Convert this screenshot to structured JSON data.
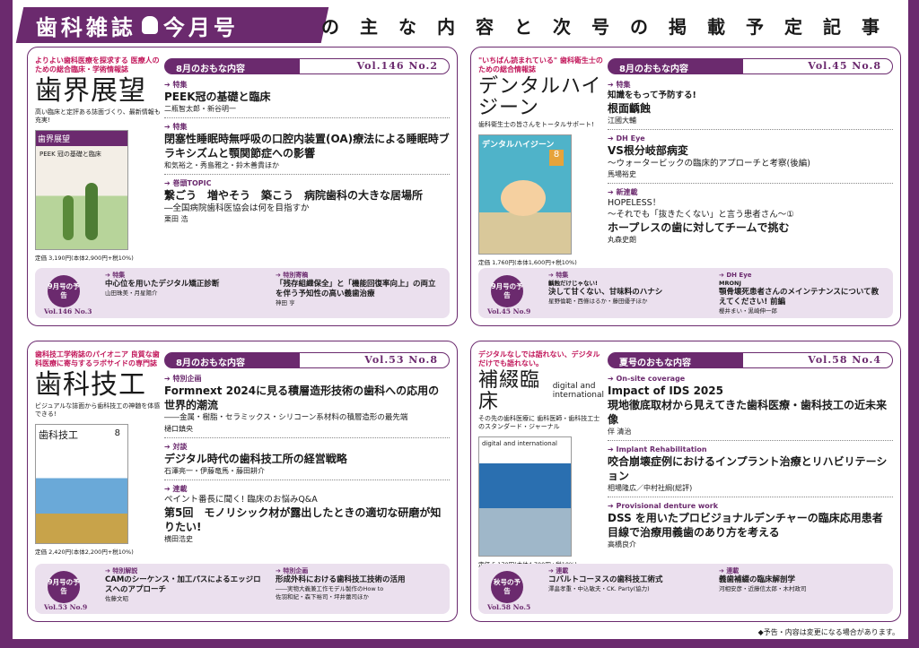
{
  "header": {
    "logo_part1": "歯科雑誌",
    "logo_part2": "今月号",
    "headline": "の主な内容と次号の掲載予定記事"
  },
  "colors": {
    "accent": "#6b2a6e",
    "tagline": "#c2185b",
    "next_bg": "#ebe0ee"
  },
  "panels": [
    {
      "tagline": "よりよい歯科医療を探求する 医療人のための総合臨床・学術情報誌",
      "title": "歯界展望",
      "subtitle": "高い臨床と定評ある誌面づくり、最新情報も充実!",
      "cover_text": "PEEK 冠の基礎と臨床",
      "price": "定価 3,190円(本体2,900円+税10%)",
      "month_label": "8月のおもな内容",
      "vol": "Vol.146 No.2",
      "articles": [
        {
          "cat": "特集",
          "title": "PEEK冠の基礎と臨床",
          "authors": "二瓶智太郎・新谷明一"
        },
        {
          "cat": "特集",
          "title": "閉塞性睡眠時無呼吸の口腔内装置(OA)療法による睡眠時ブラキシズムと顎関節症への影響",
          "authors": "和気裕之・秀島雅之・鈴木善貴ほか"
        },
        {
          "cat": "巻頭TOPIC",
          "title": "繋ごう　増やそう　築こう　病院歯科の大きな居場所",
          "sub": "―全国病院歯科医協会は何を目指すか",
          "authors": "栗田 浩"
        }
      ],
      "next": {
        "badge": "9月号の予告",
        "vol": "Vol.146 No.3",
        "items": [
          {
            "cat": "特集",
            "title": "中心位を用いたデジタル矯正診断",
            "authors": "山田珠美・月星陽介"
          },
          {
            "cat": "特別寄稿",
            "title": "「残存組織保全」と「機能回復率向上」の両立を伴う予知性の高い義歯治療",
            "authors": "神田 亨"
          }
        ]
      }
    },
    {
      "tagline": "\"いちばん読まれている\" 歯科衛生士のための総合情報誌",
      "title": "デンタルハイジーン",
      "subtitle": "歯科衛生士の皆さんをトータルサポート!",
      "cover_text": "デンタルハイジーン",
      "price": "定価 1,760円(本体1,600円+税10%)",
      "month_label": "8月のおもな内容",
      "vol": "Vol.45 No.8",
      "articles": [
        {
          "cat": "特集",
          "sub": "知識をもって予防する!",
          "title": "根面齲蝕",
          "authors": "江國大輔"
        },
        {
          "cat": "DH Eye",
          "title": "VS根分岐部病変",
          "sub2": "～ウォータービックの臨床的アプローチと考察(後編)",
          "authors": "馬場裕史"
        },
        {
          "cat": "新連載",
          "sub": "HOPELESS！",
          "sub2": "～それでも「抜きたくない」と言う患者さん～①",
          "title": "ホープレスの歯に対してチームで挑む",
          "authors": "丸森史朗"
        }
      ],
      "next": {
        "badge": "9月号の予告",
        "vol": "Vol.45 No.9",
        "items": [
          {
            "cat": "特集",
            "sub": "齲蝕だけじゃない!",
            "title": "決して甘くない、甘味料のハナシ",
            "authors": "星野倫範・西條はるか・藤田優子ほか"
          },
          {
            "cat": "DH Eye",
            "sub": "MRONJ",
            "title": "顎骨壊死患者さんのメインテナンスについて教えてください! 前編",
            "authors": "櫻井まい・黒崎伸一郎"
          }
        ]
      }
    },
    {
      "tagline": "歯科技工学術誌のパイオニア 良質な歯科医療に寄与するラボサイドの専門誌",
      "title": "歯科技工",
      "subtitle": "ビジュアルな誌面から歯科技工の神髄を体感できる!",
      "cover_text": "歯科技工",
      "price": "定価 2,420円(本体2,200円+税10%)",
      "month_label": "8月のおもな内容",
      "vol": "Vol.53 No.8",
      "articles": [
        {
          "cat": "特別企画",
          "title": "Formnext 2024に見る積層造形技術の歯科への応用の世界的潮流",
          "sub": "――金属・樹脂・セラミックス・シリコーン系材料の積層造形の最先端",
          "authors": "樋口鎮央"
        },
        {
          "cat": "対談",
          "title": "デジタル時代の歯科技工所の経営戦略",
          "authors": "石澤亮一・伊藤竜馬・藤田耕介"
        },
        {
          "cat": "連載",
          "sub": "ペイント番長に聞く! 臨床のお悩みQ&A",
          "title": "第5回　モノリシック材が露出したときの適切な研磨が知りたい!",
          "authors": "横田浩史"
        }
      ],
      "next": {
        "badge": "9月号の予告",
        "vol": "Vol.53 No.9",
        "items": [
          {
            "cat": "特別解説",
            "title": "CAMのシーケンス・加工パスによるエッジロスへのアプローチ",
            "authors": "佐藤文昭"
          },
          {
            "cat": "特別企画",
            "title": "形成外科における歯科技工技術の活用",
            "sub": "――実物大義兼工作モデル製作のHow to",
            "authors": "佐羽和紀・森下裕司・坪井蕾司ほか"
          }
        ]
      }
    },
    {
      "tagline": "デジタルなしでは語れない、デジタルだけでも語れない。",
      "title": "補綴臨床",
      "title_en": "digital and international",
      "subtitle": "その先の歯科医療に 歯科医師・歯科技工士のスタンダード・ジャーナル",
      "cover_text": "digital and international",
      "price": "定価 5,170円(本体4,700円+税10%)",
      "month_label": "夏号のおもな内容",
      "vol": "Vol.58 No.4",
      "articles": [
        {
          "cat": "On-site coverage",
          "title": "Impact of IDS 2025",
          "title2": "現地徹底取材から見えてきた歯科医療・歯科技工の近未来像",
          "authors": "伴 清治"
        },
        {
          "cat": "Implant Rehabilitation",
          "title": "咬合崩壊症例におけるインプラント治療とリハビリテーション",
          "authors": "相場隆広／中村社綱(総評)"
        },
        {
          "cat": "Provisional denture work",
          "title": "DSS を用いたプロビジョナルデンチャーの臨床応用患者目線で治療用義歯のあり方を考える",
          "authors": "高橋良介"
        }
      ],
      "next": {
        "badge": "秋号の予告",
        "vol": "Vol.58 No.5",
        "items": [
          {
            "cat": "連載",
            "title": "コバルトコーヌスの歯科技工術式",
            "authors": "澤畠孝重・中込敏夫・CK. Party(協力)"
          },
          {
            "cat": "連載",
            "title": "義歯補綴の臨床解剖学",
            "authors": "河相安彦・近藤信太郎・木村政司"
          }
        ]
      }
    }
  ],
  "footnote": "◆予告・内容は変更になる場合があります。"
}
